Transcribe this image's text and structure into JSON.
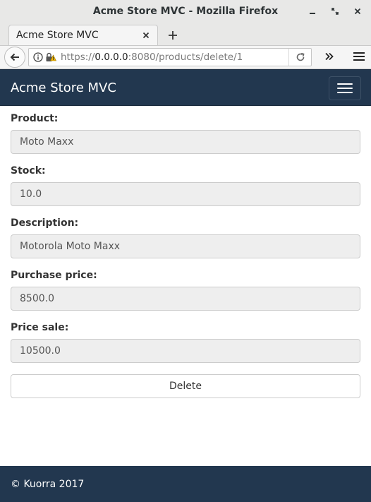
{
  "window": {
    "title": "Acme Store MVC - Mozilla Firefox",
    "controls": {
      "minimize": "–",
      "maximize": "⤢",
      "close": "✕"
    }
  },
  "tabs": [
    {
      "title": "Acme Store MVC",
      "active": true
    }
  ],
  "navbar": {
    "url_scheme": "https://",
    "url_host": "0.0.0.0",
    "url_rest": ":8080/products/delete/1"
  },
  "app": {
    "brand": "Acme Store MVC"
  },
  "form": {
    "fields": [
      {
        "label": "Product:",
        "value": "Moto Maxx"
      },
      {
        "label": "Stock:",
        "value": "10.0"
      },
      {
        "label": "Description:",
        "value": "Motorola Moto Maxx"
      },
      {
        "label": "Purchase price:",
        "value": "8500.0"
      },
      {
        "label": "Price sale:",
        "value": "10500.0"
      }
    ],
    "submit_label": "Delete"
  },
  "footer": {
    "text": "© Kuorra 2017"
  },
  "colors": {
    "header_bg": "#22374f",
    "input_bg": "#eeeeee"
  }
}
